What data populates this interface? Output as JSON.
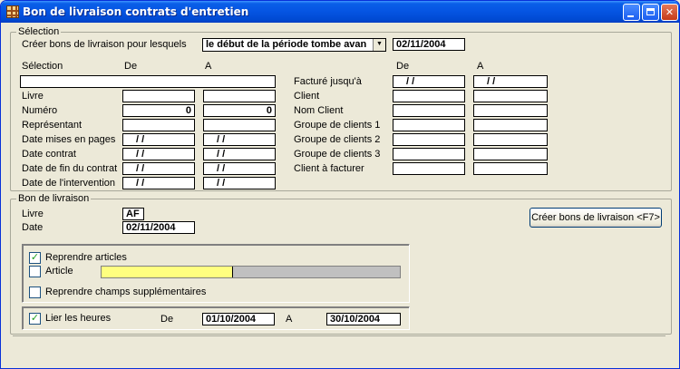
{
  "window": {
    "title": "Bon de livraison contrats d'entretien"
  },
  "selection": {
    "group_label": "Sélection",
    "create_label": "Créer bons de livraison pour lesquels",
    "create_option": "le début de la période tombe avan",
    "create_date": "02/11/2004",
    "col_selection": "Sélection",
    "col_de": "De",
    "col_a": "A",
    "col_de_right": "De",
    "col_a_right": "A",
    "selection_value": "",
    "left_rows": [
      {
        "label": "Livre",
        "de": "",
        "a": ""
      },
      {
        "label": "Numéro",
        "de": "0",
        "a": "0"
      },
      {
        "label": "Représentant",
        "de": "",
        "a": ""
      },
      {
        "label": "Date mises en pages",
        "de": "/ /",
        "a": "/ /"
      },
      {
        "label": "Date contrat",
        "de": "/ /",
        "a": "/ /"
      },
      {
        "label": "Date de fin du contrat",
        "de": "/ /",
        "a": "/ /"
      },
      {
        "label": "Date de l'intervention",
        "de": "/ /",
        "a": "/ /"
      }
    ],
    "right_rows": [
      {
        "label": "Facturé jusqu'à",
        "de": "/ /",
        "a": "/ /"
      },
      {
        "label": "Client",
        "de": "",
        "a": ""
      },
      {
        "label": "Nom Client",
        "de": "",
        "a": ""
      },
      {
        "label": "Groupe de clients 1",
        "de": "",
        "a": ""
      },
      {
        "label": "Groupe de clients 2",
        "de": "",
        "a": ""
      },
      {
        "label": "Groupe de clients 3",
        "de": "",
        "a": ""
      },
      {
        "label": "Client à facturer",
        "de": "",
        "a": ""
      }
    ]
  },
  "delivery": {
    "group_label": "Bon de livraison",
    "livre_label": "Livre",
    "livre_value": "AF",
    "date_label": "Date",
    "date_value": "02/11/2004",
    "create_button": "Créer bons de livraison <F7>",
    "reprendre_articles": {
      "label": "Reprendre articles",
      "checked": true
    },
    "article": {
      "label": "Article",
      "checked": false,
      "progress": 0.45
    },
    "reprendre_champs": {
      "label": "Reprendre champs supplémentaires",
      "checked": false
    },
    "lier_heures": {
      "label": "Lier les heures",
      "checked": true
    },
    "heures_de_label": "De",
    "heures_de": "01/10/2004",
    "heures_a_label": "A",
    "heures_a": "30/10/2004"
  },
  "icons": {
    "app": "app-grid-icon",
    "minimize": "minimize-icon",
    "maximize": "maximize-icon",
    "close": "close-icon",
    "dropdown": "chevron-down-icon",
    "check": "check-icon"
  }
}
